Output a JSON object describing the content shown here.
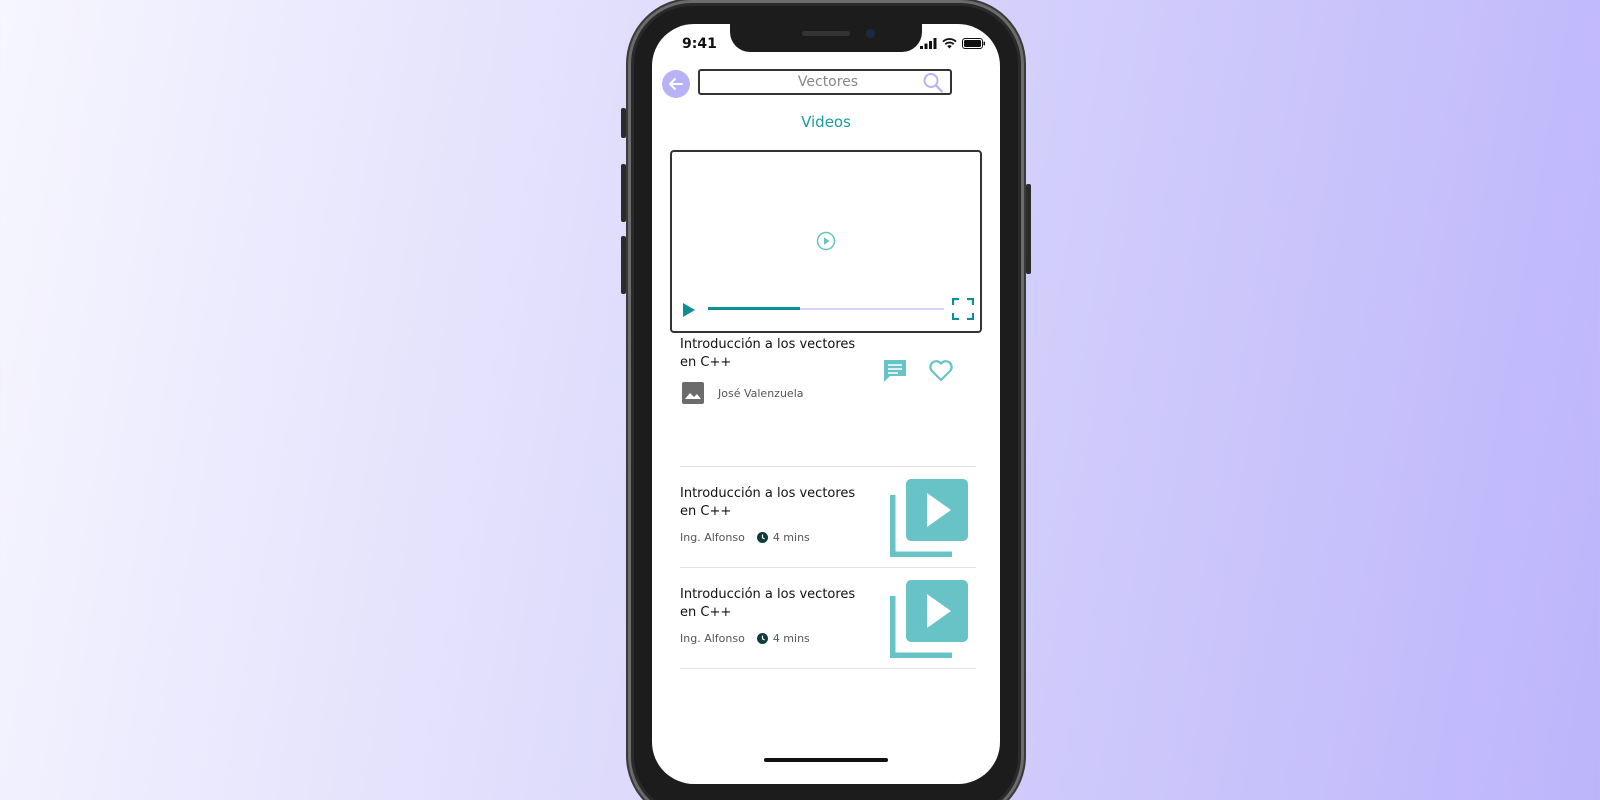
{
  "status_bar": {
    "time": "9:41"
  },
  "search": {
    "query": "Vectores"
  },
  "section": {
    "title": "Videos"
  },
  "player": {
    "progress": 0.39
  },
  "featured": {
    "title": "Introducción a los vectores en C++",
    "author": "José Valenzuela"
  },
  "videos": [
    {
      "title": "Introducción a los vectores en C++",
      "author": "Ing. Alfonso",
      "duration": "4 mins"
    },
    {
      "title": "Introducción a los vectores en C++",
      "author": "Ing. Alfonso",
      "duration": "4 mins"
    }
  ],
  "colors": {
    "accent": "#1b9aa0",
    "thumbnail": "#68c3c7",
    "back_button": "#b8b1f6",
    "progress": "#0c8f96"
  }
}
